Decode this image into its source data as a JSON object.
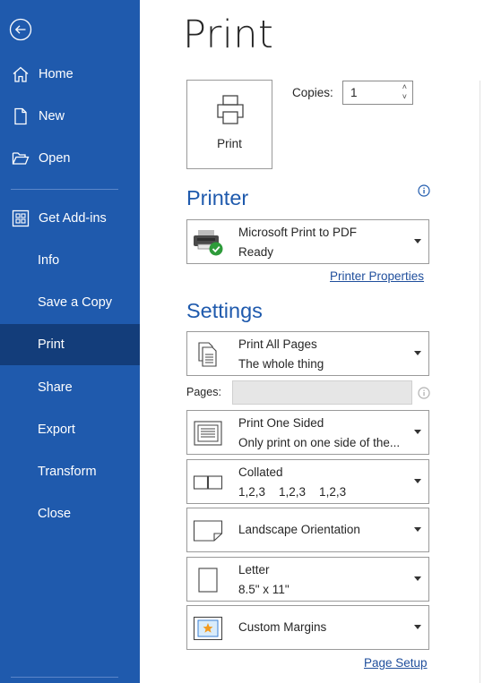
{
  "sidebar": {
    "back_label": "Back",
    "items": [
      {
        "label": "Home",
        "icon": "home-icon"
      },
      {
        "label": "New",
        "icon": "new-document-icon"
      },
      {
        "label": "Open",
        "icon": "folder-open-icon"
      },
      {
        "label": "Get Add-ins",
        "icon": "add-ins-icon"
      },
      {
        "label": "Info"
      },
      {
        "label": "Save a Copy"
      },
      {
        "label": "Print",
        "active": true
      },
      {
        "label": "Share"
      },
      {
        "label": "Export"
      },
      {
        "label": "Transform"
      },
      {
        "label": "Close"
      }
    ]
  },
  "main": {
    "title": "Print",
    "print_button_label": "Print",
    "copies_label": "Copies:",
    "copies_value": "1",
    "printer": {
      "section_title": "Printer",
      "name": "Microsoft Print to PDF",
      "status": "Ready",
      "properties_link": "Printer Properties"
    },
    "settings": {
      "section_title": "Settings",
      "pages_label": "Pages:",
      "pages_value": "",
      "options": [
        {
          "line1": "Print All Pages",
          "line2": "The whole thing",
          "icon": "pages-icon"
        },
        {
          "line1": "Print One Sided",
          "line2": "Only print on one side of the...",
          "icon": "one-sided-icon"
        },
        {
          "line1": "Collated",
          "line2": "1,2,3    1,2,3    1,2,3",
          "icon": "collated-icon"
        },
        {
          "line1": "Landscape Orientation",
          "icon": "landscape-icon"
        },
        {
          "line1": "Letter",
          "line2": "8.5\" x 11\"",
          "icon": "paper-size-icon"
        },
        {
          "line1": "Custom Margins",
          "icon": "margins-icon"
        }
      ],
      "page_setup_link": "Page Setup"
    }
  },
  "colors": {
    "sidebar_bg": "#1f5aad",
    "sidebar_active": "#133d7a",
    "accent": "#1f5aad",
    "link": "#1f4e9c",
    "ready_green": "#2e9b3a"
  }
}
